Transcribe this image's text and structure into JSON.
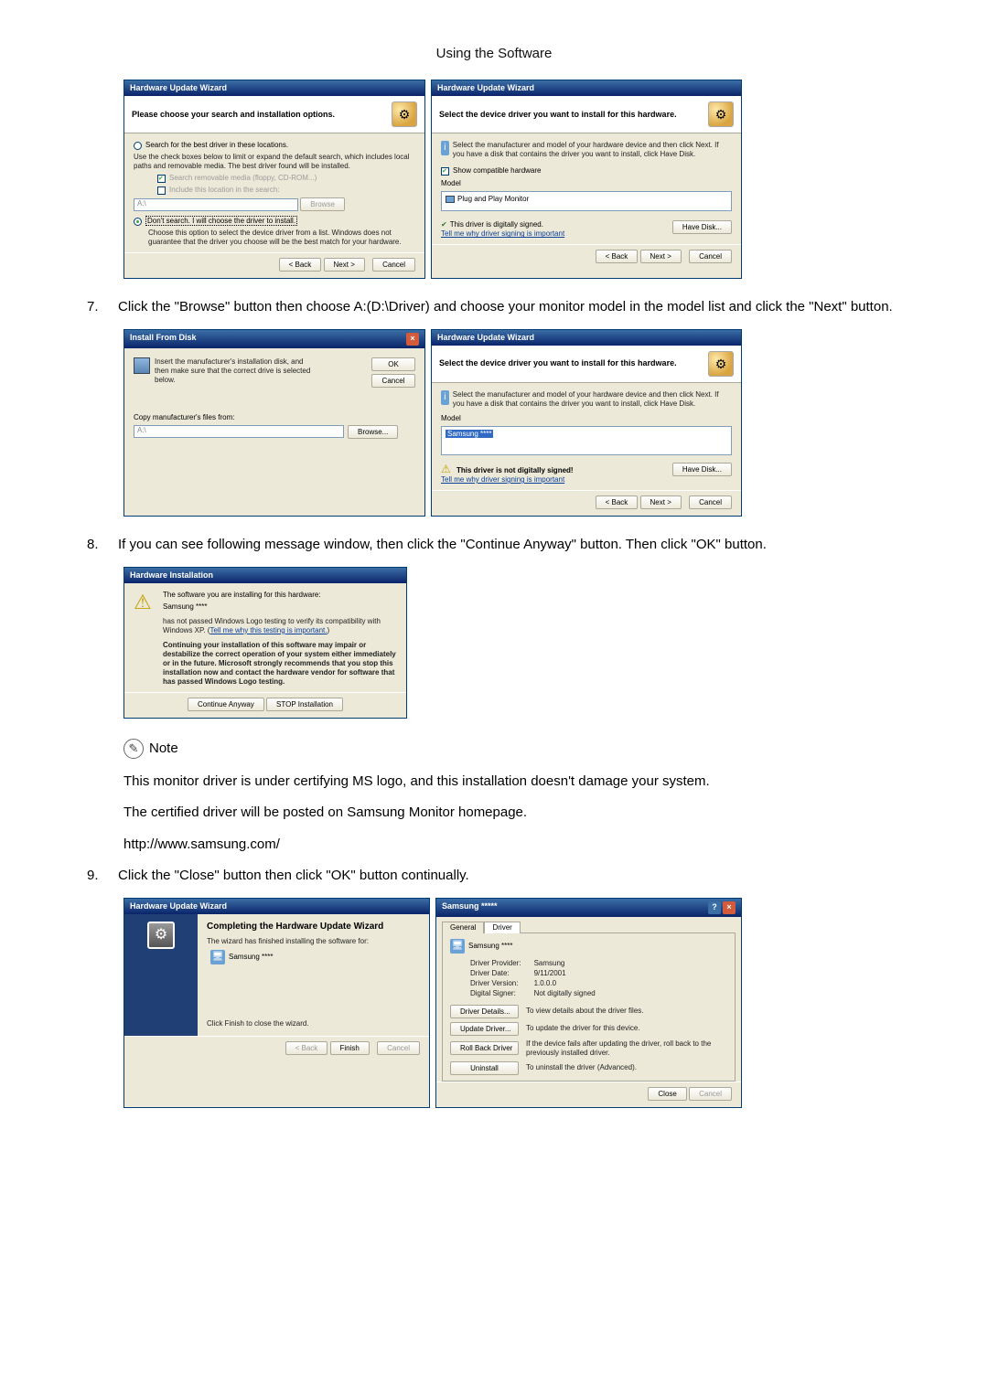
{
  "page_header": "Using the Software",
  "steps": {
    "s7": "Click the \"Browse\" button then choose A:(D:\\Driver) and choose your monitor model in the model list and click the \"Next\" button.",
    "s8": "If you can see following message window, then click the \"Continue Anyway\" button. Then click \"OK\" button.",
    "s9": "Click the \"Close\" button then click \"OK\" button continually."
  },
  "note_label": "Note",
  "note_body1": "This monitor driver is under certifying MS logo, and this installation doesn't damage your system.",
  "note_body2": "The certified driver will be posted on Samsung Monitor homepage.",
  "note_url": "http://www.samsung.com/",
  "dlg_wizard1": {
    "title": "Hardware Update Wizard",
    "heading": "Please choose your search and installation options.",
    "opt1": "Search for the best driver in these locations.",
    "opt1_sub": "Use the check boxes below to limit or expand the default search, which includes local paths and removable media. The best driver found will be installed.",
    "chk1": "Search removable media (floppy, CD-ROM...)",
    "chk2": "Include this location in the search:",
    "path": "A:\\",
    "browse": "Browse",
    "opt2": "Don't search. I will choose the driver to install.",
    "opt2_sub": "Choose this option to select the device driver from a list. Windows does not guarantee that the driver you choose will be the best match for your hardware.",
    "back": "< Back",
    "next": "Next >",
    "cancel": "Cancel"
  },
  "dlg_wizard2": {
    "title": "Hardware Update Wizard",
    "heading": "Select the device driver you want to install for this hardware.",
    "instr": "Select the manufacturer and model of your hardware device and then click Next. If you have a disk that contains the driver you want to install, click Have Disk.",
    "show_compat": "Show compatible hardware",
    "model_label": "Model",
    "model_item": "Plug and Play Monitor",
    "signed": "This driver is digitally signed.",
    "tell_me": "Tell me why driver signing is important",
    "have_disk": "Have Disk...",
    "back": "< Back",
    "next": "Next >",
    "cancel": "Cancel"
  },
  "dlg_install_from_disk": {
    "title": "Install From Disk",
    "instr": "Insert the manufacturer's installation disk, and then make sure that the correct drive is selected below.",
    "ok": "OK",
    "cancel": "Cancel",
    "copy_label": "Copy manufacturer's files from:",
    "path": "A:\\",
    "browse": "Browse..."
  },
  "dlg_wizard3": {
    "title": "Hardware Update Wizard",
    "heading": "Select the device driver you want to install for this hardware.",
    "instr": "Select the manufacturer and model of your hardware device and then click Next. If you have a disk that contains the driver you want to install, click Have Disk.",
    "model_label": "Model",
    "model_item": "Samsung ****",
    "unsigned": "This driver is not digitally signed!",
    "tell_me": "Tell me why driver signing is important",
    "have_disk": "Have Disk...",
    "back": "< Back",
    "next": "Next >",
    "cancel": "Cancel"
  },
  "dlg_hw_install": {
    "title": "Hardware Installation",
    "line1": "The software you are installing for this hardware:",
    "line2": "Samsung ****",
    "line3": "has not passed Windows Logo testing to verify its compatibility with Windows XP. (",
    "line3_link": "Tell me why this testing is important.",
    "line3_close": ")",
    "bold_warn": "Continuing your installation of this software may impair or destabilize the correct operation of your system either immediately or in the future. Microsoft strongly recommends that you stop this installation now and contact the hardware vendor for software that has passed Windows Logo testing.",
    "continue": "Continue Anyway",
    "stop": "STOP Installation"
  },
  "dlg_wizard_complete": {
    "title": "Hardware Update Wizard",
    "heading": "Completing the Hardware Update Wizard",
    "line1": "The wizard has finished installing the software for:",
    "device": "Samsung ****",
    "click_finish": "Click Finish to close the wizard.",
    "back": "< Back",
    "finish": "Finish",
    "cancel": "Cancel"
  },
  "dlg_driver_props": {
    "title": "Samsung *****",
    "tab_general": "General",
    "tab_driver": "Driver",
    "device": "Samsung ****",
    "provider_label": "Driver Provider:",
    "provider": "Samsung",
    "date_label": "Driver Date:",
    "date": "9/11/2001",
    "version_label": "Driver Version:",
    "version": "1.0.0.0",
    "signer_label": "Digital Signer:",
    "signer": "Not digitally signed",
    "btn_details": "Driver Details...",
    "btn_details_desc": "To view details about the driver files.",
    "btn_update": "Update Driver...",
    "btn_update_desc": "To update the driver for this device.",
    "btn_rollback": "Roll Back Driver",
    "btn_rollback_desc": "If the device fails after updating the driver, roll back to the previously installed driver.",
    "btn_uninstall": "Uninstall",
    "btn_uninstall_desc": "To uninstall the driver (Advanced).",
    "close": "Close",
    "cancel": "Cancel"
  }
}
